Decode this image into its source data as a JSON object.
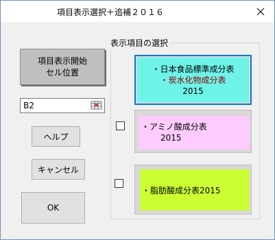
{
  "window": {
    "title": "項目表示選択＋追補２０１６"
  },
  "left_panel": {
    "position_button": {
      "line1": "項目表示開始",
      "line2": "セル位置"
    },
    "refedit_value": "B2",
    "help_label": "ヘルプ",
    "cancel_label": "キャンセル",
    "ok_label": "OK"
  },
  "group": {
    "label": "表示項目の選択",
    "items": [
      {
        "line1": "・日本食品標準成分表",
        "line2": "・炭水化物成分表",
        "line3": "2015",
        "color": "#6ef3e8",
        "line2_color": "#8b0000"
      },
      {
        "line1": "・アミノ酸成分表",
        "line2": "2015",
        "color": "#ffccff"
      },
      {
        "line1": "・脂肪酸成分表2015",
        "color": "#ccff33"
      }
    ]
  },
  "colors": {
    "accent": "#0078d7"
  }
}
